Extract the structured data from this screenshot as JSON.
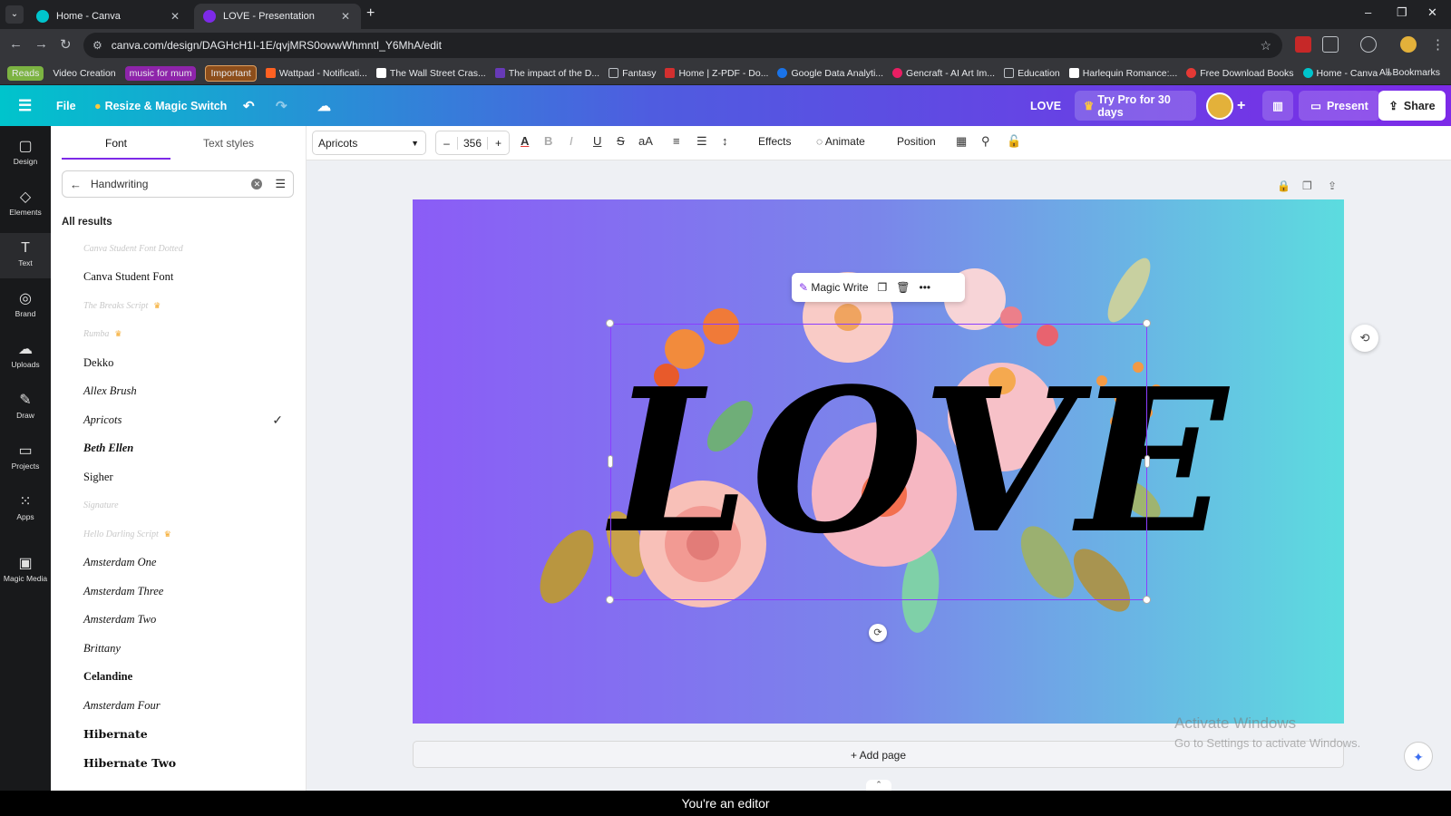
{
  "browser": {
    "tabs": [
      {
        "title": "Home - Canva",
        "active": false
      },
      {
        "title": "LOVE - Presentation",
        "active": true
      }
    ],
    "url": "canva.com/design/DAGHcH1I-1E/qvjMRS0owwWhmntI_Y6MhA/edit",
    "bookmarks": [
      {
        "label": "Reads",
        "color": "#7cb342"
      },
      {
        "label": "Video Creation",
        "color": ""
      },
      {
        "label": "music for mum",
        "color": "#8e24aa"
      },
      {
        "label": "Important",
        "color": "#8d4e1b"
      },
      {
        "label": "Wattpad - Notificati...",
        "color": ""
      },
      {
        "label": "The Wall Street Cras...",
        "color": ""
      },
      {
        "label": "The impact of the D...",
        "color": ""
      },
      {
        "label": "Fantasy",
        "color": ""
      },
      {
        "label": "Home | Z-PDF - Do...",
        "color": ""
      },
      {
        "label": "Google Data Analyti...",
        "color": ""
      },
      {
        "label": "Gencraft - AI Art Im...",
        "color": ""
      },
      {
        "label": "Education",
        "color": ""
      },
      {
        "label": "Harlequin Romance:...",
        "color": ""
      },
      {
        "label": "Free Download Books",
        "color": ""
      },
      {
        "label": "Home - Canva",
        "color": ""
      }
    ],
    "all_bookmarks": "All Bookmarks",
    "more": "»"
  },
  "canva_header": {
    "file": "File",
    "resize": "Resize & Magic Switch",
    "design_title": "LOVE",
    "try_pro": "Try Pro for 30 days",
    "present": "Present",
    "share": "Share"
  },
  "rail": [
    {
      "label": "Design",
      "icon": "▢"
    },
    {
      "label": "Elements",
      "icon": "◇"
    },
    {
      "label": "Text",
      "icon": "T"
    },
    {
      "label": "Brand",
      "icon": "◎"
    },
    {
      "label": "Uploads",
      "icon": "☁"
    },
    {
      "label": "Draw",
      "icon": "✎"
    },
    {
      "label": "Projects",
      "icon": "▭"
    },
    {
      "label": "Apps",
      "icon": "⁙"
    },
    {
      "label": "Magic Media",
      "icon": "▣"
    }
  ],
  "panel": {
    "tabs": [
      "Font",
      "Text styles"
    ],
    "search_value": "Handwriting",
    "results_heading": "All results",
    "fonts": [
      {
        "name": "Canva Student Font Dotted",
        "crown": false,
        "faded": true
      },
      {
        "name": "Canva Student Font",
        "crown": false,
        "faded": false
      },
      {
        "name": "The Breaks Script",
        "crown": true,
        "faded": true
      },
      {
        "name": "Rumba",
        "crown": true,
        "faded": true
      },
      {
        "name": "Dekko",
        "crown": false,
        "faded": false
      },
      {
        "name": "Allex Brush",
        "crown": false,
        "faded": false
      },
      {
        "name": "Apricots",
        "crown": false,
        "faded": false,
        "selected": true
      },
      {
        "name": "Beth Ellen",
        "crown": false,
        "faded": false
      },
      {
        "name": "Sigher",
        "crown": false,
        "faded": false
      },
      {
        "name": "Signature",
        "crown": false,
        "faded": true
      },
      {
        "name": "Hello Darling Script",
        "crown": true,
        "faded": true
      },
      {
        "name": "Amsterdam One",
        "crown": false,
        "faded": false
      },
      {
        "name": "Amsterdam Three",
        "crown": false,
        "faded": false
      },
      {
        "name": "Amsterdam Two",
        "crown": false,
        "faded": false
      },
      {
        "name": "Brittany",
        "crown": false,
        "faded": false
      },
      {
        "name": "Celandine",
        "crown": false,
        "faded": false
      },
      {
        "name": "Amsterdam Four",
        "crown": false,
        "faded": false
      },
      {
        "name": "Hibernate",
        "crown": false,
        "faded": false
      },
      {
        "name": "Hibernate Two",
        "crown": false,
        "faded": false
      }
    ]
  },
  "context_toolbar": {
    "font_name": "Apricots",
    "font_size": "356",
    "minus": "–",
    "plus": "+",
    "effects": "Effects",
    "animate": "Animate",
    "position": "Position"
  },
  "floating_menu": {
    "magic_write": "Magic Write"
  },
  "canvas": {
    "text": "LOVE"
  },
  "add_page": "+ Add page",
  "watermark": {
    "line1": "Activate Windows",
    "line2": "Go to Settings to activate Windows."
  },
  "status": "You're an editor",
  "colors": {
    "accent": "#7d2ae8",
    "selection": "#8b3dff"
  }
}
